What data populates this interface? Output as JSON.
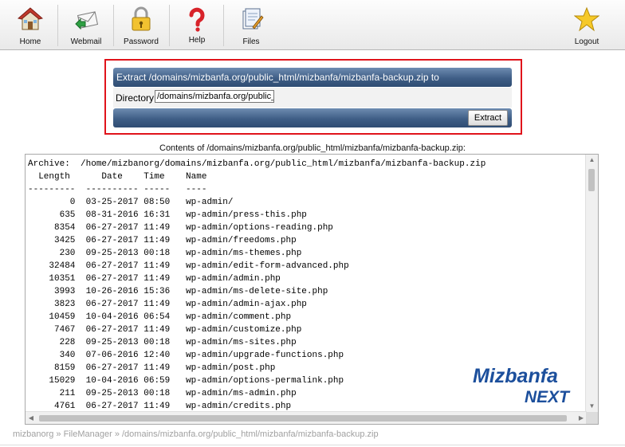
{
  "toolbar": {
    "items": [
      {
        "label": "Home",
        "icon": "home-icon"
      },
      {
        "label": "Webmail",
        "icon": "mail-icon"
      },
      {
        "label": "Password",
        "icon": "lock-icon"
      },
      {
        "label": "Help",
        "icon": "question-icon"
      },
      {
        "label": "Files",
        "icon": "files-icon"
      }
    ],
    "logout": {
      "label": "Logout",
      "icon": "star-icon"
    }
  },
  "extract": {
    "title": "Extract /domains/mizbanfa.org/public_html/mizbanfa/mizbanfa-backup.zip to",
    "directory_label": "Directory:",
    "directory_value": "/domains/mizbanfa.org/public_html/mizbanfa",
    "button_label": "Extract"
  },
  "contents_caption": "Contents of /domains/mizbanfa.org/public_html/mizbanfa/mizbanfa-backup.zip:",
  "listing": {
    "archive_line": "Archive:  /home/mizbanorg/domains/mizbanfa.org/public_html/mizbanfa/mizbanfa-backup.zip",
    "header_line": "  Length      Date    Time    Name",
    "rule_line": "---------  ---------- -----   ----",
    "rows": [
      {
        "length": "0",
        "date": "03-25-2017",
        "time": "08:50",
        "name": "wp-admin/"
      },
      {
        "length": "635",
        "date": "08-31-2016",
        "time": "16:31",
        "name": "wp-admin/press-this.php"
      },
      {
        "length": "8354",
        "date": "06-27-2017",
        "time": "11:49",
        "name": "wp-admin/options-reading.php"
      },
      {
        "length": "3425",
        "date": "06-27-2017",
        "time": "11:49",
        "name": "wp-admin/freedoms.php"
      },
      {
        "length": "230",
        "date": "09-25-2013",
        "time": "00:18",
        "name": "wp-admin/ms-themes.php"
      },
      {
        "length": "32484",
        "date": "06-27-2017",
        "time": "11:49",
        "name": "wp-admin/edit-form-advanced.php"
      },
      {
        "length": "10351",
        "date": "06-27-2017",
        "time": "11:49",
        "name": "wp-admin/admin.php"
      },
      {
        "length": "3993",
        "date": "10-26-2016",
        "time": "15:36",
        "name": "wp-admin/ms-delete-site.php"
      },
      {
        "length": "3823",
        "date": "06-27-2017",
        "time": "11:49",
        "name": "wp-admin/admin-ajax.php"
      },
      {
        "length": "10459",
        "date": "10-04-2016",
        "time": "06:54",
        "name": "wp-admin/comment.php"
      },
      {
        "length": "7467",
        "date": "06-27-2017",
        "time": "11:49",
        "name": "wp-admin/customize.php"
      },
      {
        "length": "228",
        "date": "09-25-2013",
        "time": "00:18",
        "name": "wp-admin/ms-sites.php"
      },
      {
        "length": "340",
        "date": "07-06-2016",
        "time": "12:40",
        "name": "wp-admin/upgrade-functions.php"
      },
      {
        "length": "8159",
        "date": "06-27-2017",
        "time": "11:49",
        "name": "wp-admin/post.php"
      },
      {
        "length": "15029",
        "date": "10-04-2016",
        "time": "06:59",
        "name": "wp-admin/options-permalink.php"
      },
      {
        "length": "211",
        "date": "09-25-2013",
        "time": "00:18",
        "name": "wp-admin/ms-admin.php"
      },
      {
        "length": "4761",
        "date": "06-27-2017",
        "time": "11:49",
        "name": "wp-admin/credits.php"
      }
    ]
  },
  "watermark": {
    "line1": "Mizbanfa",
    "line2": "NEXT"
  },
  "breadcrumb": {
    "root": "mizbanorg",
    "sep": "»",
    "section": "FileManager",
    "path": "/domains/mizbanfa.org/public_html/mizbanfa/mizbanfa-backup.zip"
  },
  "colors": {
    "highlight": "#e0131b",
    "bar": "#3f5e86",
    "watermark_blue": "#1c4f9c"
  }
}
